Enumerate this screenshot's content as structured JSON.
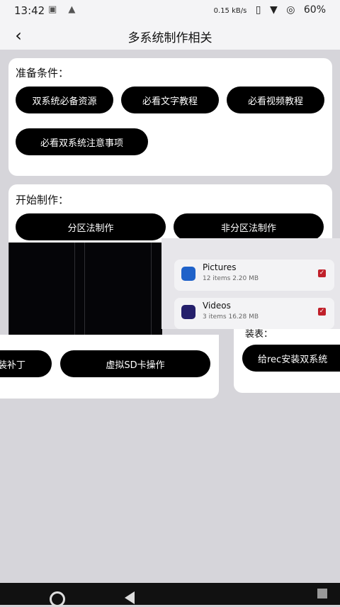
{
  "statusbar": {
    "time": "13:42",
    "left_icons": "▣ ▲",
    "net_speed": "0.15 kB/s",
    "battery": "60%"
  },
  "appbar": {
    "title": "多系统制作相关",
    "back_icon": "‹"
  },
  "prepare": {
    "label": "准备条件：",
    "buttons": [
      "双系统必备资源",
      "必看文字教程",
      "必看视频教程",
      "必看双系统注意事项"
    ]
  },
  "start": {
    "label": "开始制作：",
    "buttons": [
      "分区法制作",
      "非分区法制作"
    ]
  },
  "overlay": {
    "partial_patch_button": "装补丁",
    "virtual_sd_button": "虚拟SD卡操作",
    "partial_install_label": "装表：",
    "rec_install_button": "给rec安装双系统"
  },
  "files": [
    {
      "name": "Pictures",
      "meta": "12 items   2.20 MB",
      "color": "#1f62c9"
    },
    {
      "name": "Videos",
      "meta": "3 items   16.28 MB",
      "color": "#241f6b"
    }
  ]
}
